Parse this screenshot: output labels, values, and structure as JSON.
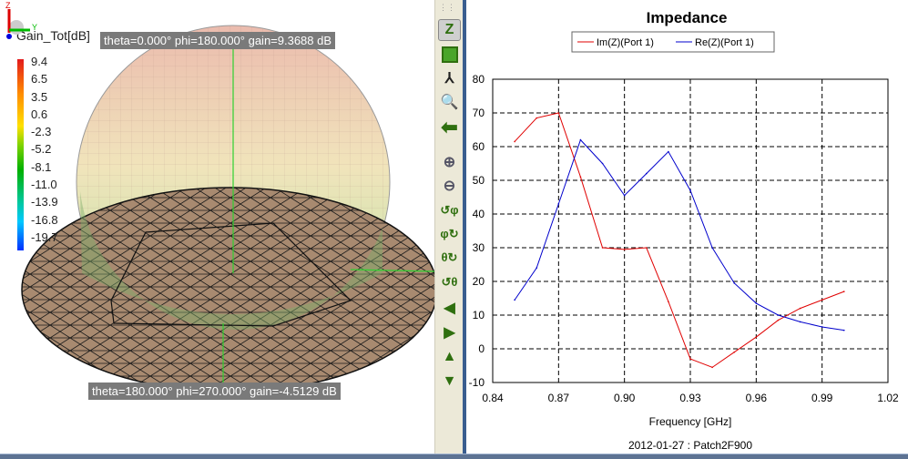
{
  "view3d": {
    "legend_title": "Gain_Tot[dB]",
    "scale_ticks": [
      "9.4",
      "6.5",
      "3.5",
      "0.6",
      "-2.3",
      "-5.2",
      "-8.1",
      "-11.0",
      "-13.9",
      "-16.8",
      "-19.7"
    ],
    "top_tooltip": "theta=0.000° phi=180.000° gain=9.3688 dB",
    "bottom_tooltip": "theta=180.000° phi=270.000° gain=-4.5129 dB",
    "axis_labels": {
      "z": "Z",
      "y": "Y"
    }
  },
  "toolbar": {
    "items": [
      "view-z",
      "fit-all",
      "axes-r",
      "zoom-window",
      "back",
      "zoom-in",
      "zoom-out",
      "rotate-phi-ccw",
      "rotate-phi-cw",
      "rotate-theta-cw",
      "rotate-theta-ccw",
      "pan-left",
      "pan-right",
      "pan-up",
      "pan-down"
    ]
  },
  "colors": {
    "im": "#e00000",
    "re": "#0000cc"
  },
  "chart_data": {
    "type": "line",
    "title": "Impedance",
    "xlabel": "Frequency [GHz]",
    "ylabel": "",
    "footer": "2012-01-27 : Patch2F900",
    "xlim": [
      0.84,
      1.02
    ],
    "ylim": [
      -10,
      80
    ],
    "xticks": [
      "0.84",
      "0.87",
      "0.90",
      "0.93",
      "0.96",
      "0.99",
      "1.02"
    ],
    "yticks": [
      "80",
      "70",
      "60",
      "50",
      "40",
      "30",
      "20",
      "10",
      "0",
      "-10"
    ],
    "grid": true,
    "legend_position": "top",
    "x": [
      0.85,
      0.86,
      0.87,
      0.88,
      0.89,
      0.9,
      0.91,
      0.92,
      0.93,
      0.94,
      0.95,
      0.96,
      0.97,
      0.98,
      0.99,
      1.0
    ],
    "series": [
      {
        "name": "Im(Z)(Port 1)",
        "color": "#e00000",
        "values": [
          61.5,
          68.5,
          70,
          51,
          30,
          29.5,
          30,
          14,
          -3,
          -5.5,
          -1,
          3.5,
          8.5,
          12,
          14.5,
          17
        ]
      },
      {
        "name": "Re(Z)(Port 1)",
        "color": "#0000cc",
        "values": [
          14.5,
          24,
          43,
          62,
          55,
          45.5,
          52,
          58.5,
          47,
          30,
          19.5,
          13.5,
          10,
          8,
          6.5,
          5.5
        ]
      }
    ]
  }
}
